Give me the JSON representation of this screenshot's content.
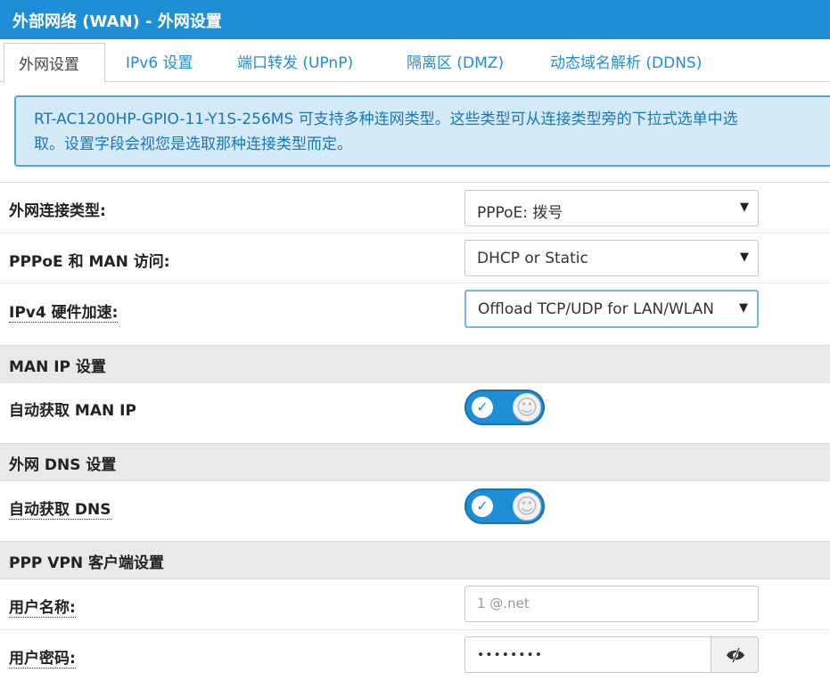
{
  "title": "外部网络 (WAN) - 外网设置",
  "tabs": [
    {
      "label": "外网设置",
      "active": true
    },
    {
      "label": "IPv6 设置"
    },
    {
      "label": "端口转发 (UPnP)"
    },
    {
      "label": "隔离区 (DMZ)"
    },
    {
      "label": "动态域名解析 (DDNS)"
    }
  ],
  "notice": {
    "line1": "RT-AC1200HP-GPIO-11-Y1S-256MS 可支持多种连网类型。这些类型可从连接类型旁的下拉式选单中选",
    "line2": "取。设置字段会视您是选取那种连接类型而定。"
  },
  "fields": {
    "wan_type": {
      "label": "外网连接类型:",
      "value": "PPPoE: 拨号"
    },
    "pppoe_man": {
      "label": "PPPoE 和 MAN 访问:",
      "value": "DHCP or Static"
    },
    "ipv4_hw": {
      "label": "IPv4 硬件加速:",
      "value": "Offload TCP/UDP for LAN/WLAN"
    }
  },
  "sections": {
    "man_ip": "MAN IP 设置",
    "wan_dns": "外网 DNS 设置",
    "ppp_vpn": "PPP VPN 客户端设置"
  },
  "toggles": {
    "auto_man_ip": {
      "label": "自动获取 MAN IP",
      "on": true
    },
    "auto_dns": {
      "label": "自动获取 DNS",
      "on": true
    }
  },
  "credentials": {
    "username_label": "用户名称:",
    "username_value": "1                    @.net",
    "password_label": "用户密码:",
    "password_value": "••••••••"
  },
  "icons": {
    "check": "✓",
    "smiley": "☺",
    "arrow": "▼"
  },
  "colors": {
    "accent": "#1e8fd6",
    "notice_bg": "#d4eaf7",
    "section_bg": "#e9e9e9"
  }
}
